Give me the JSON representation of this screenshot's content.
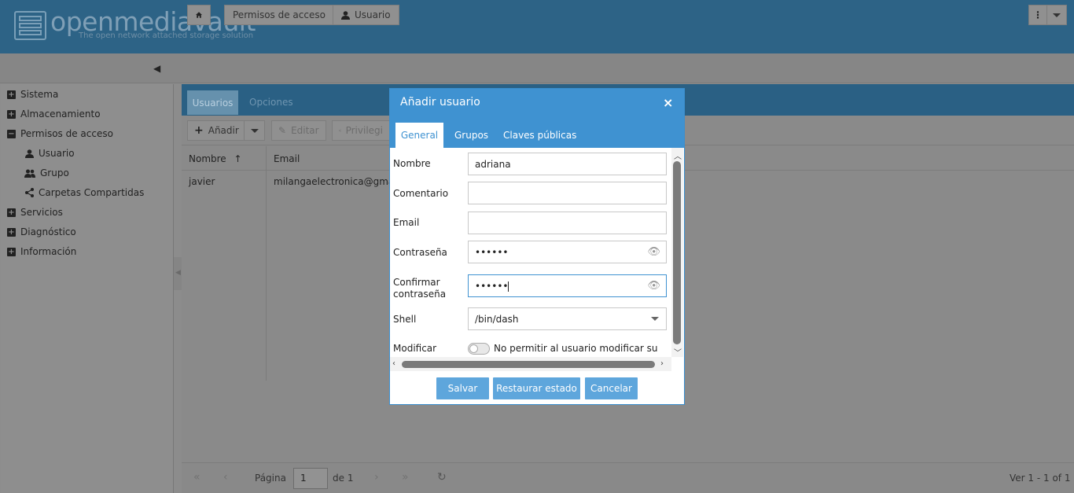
{
  "brand": {
    "name": "openmediavault",
    "tagline": "The open network attached storage solution"
  },
  "breadcrumb": {
    "items": [
      "Permisos de acceso",
      "Usuario"
    ]
  },
  "sidebar": {
    "items": [
      {
        "label": "Sistema",
        "expander": "+"
      },
      {
        "label": "Almacenamiento",
        "expander": "+"
      },
      {
        "label": "Permisos de acceso",
        "expander": "−"
      },
      {
        "label": "Usuario"
      },
      {
        "label": "Grupo"
      },
      {
        "label": "Carpetas Compartidas"
      },
      {
        "label": "Servicios",
        "expander": "+"
      },
      {
        "label": "Diagnóstico",
        "expander": "+"
      },
      {
        "label": "Información",
        "expander": "+"
      }
    ]
  },
  "main": {
    "tabs": [
      "Usuarios",
      "Opciones"
    ],
    "toolbar": {
      "add": "Añadir",
      "edit": "Editar",
      "privileges": "Privilegi"
    },
    "columns": [
      "Nombre",
      "Email"
    ],
    "rows": [
      {
        "name": "javier",
        "email": "milangaelectronica@gmail.c"
      }
    ],
    "pager": {
      "page_label": "Página",
      "page_value": "1",
      "of_label": "de 1",
      "summary": "Ver 1 - 1 of 1"
    }
  },
  "dialog": {
    "title": "Añadir usuario",
    "close": "×",
    "tabs": [
      "General",
      "Grupos",
      "Claves públicas"
    ],
    "fields": {
      "name_label": "Nombre",
      "name_value": "adriana",
      "comment_label": "Comentario",
      "comment_value": "",
      "email_label": "Email",
      "email_value": "",
      "password_label": "Contraseña",
      "password_value": "••••••",
      "confirm_label_1": "Confirmar",
      "confirm_label_2": "contraseña",
      "confirm_value": "••••••",
      "shell_label": "Shell",
      "shell_value": "/bin/dash",
      "modify_label": "Modificar",
      "modify_toggle_text": "No permitir al usuario modificar su"
    },
    "buttons": {
      "save": "Salvar",
      "reset": "Restaurar estado",
      "cancel": "Cancelar"
    }
  },
  "colors": {
    "header": "#2d6386",
    "dialog_accent": "#3f92d1",
    "button": "#5ea6dc"
  }
}
